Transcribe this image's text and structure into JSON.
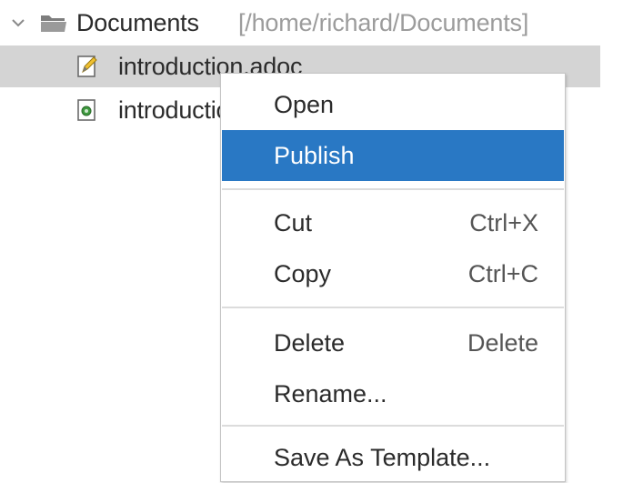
{
  "tree": {
    "folder": {
      "name": "Documents",
      "path": "[/home/richard/Documents]",
      "icon": "folder-icon",
      "expand_icon": "chevron-down-icon"
    },
    "files": [
      {
        "name": "introduction.adoc",
        "icon": "edit-document-icon",
        "selected": true
      },
      {
        "name": "introduction.html",
        "icon": "html-document-icon",
        "selected": false
      }
    ]
  },
  "context_menu": {
    "items": [
      {
        "label": "Open",
        "shortcut": ""
      },
      {
        "label": "Publish",
        "shortcut": "",
        "highlighted": true
      },
      {
        "label": "Cut",
        "shortcut": "Ctrl+X"
      },
      {
        "label": "Copy",
        "shortcut": "Ctrl+C"
      },
      {
        "label": "Delete",
        "shortcut": "Delete"
      },
      {
        "label": "Rename...",
        "shortcut": ""
      },
      {
        "label": "Save As Template...",
        "shortcut": ""
      }
    ]
  },
  "colors": {
    "highlight": "#2978c4",
    "selection": "#d4d4d4",
    "path_text": "#9c9c9c"
  }
}
